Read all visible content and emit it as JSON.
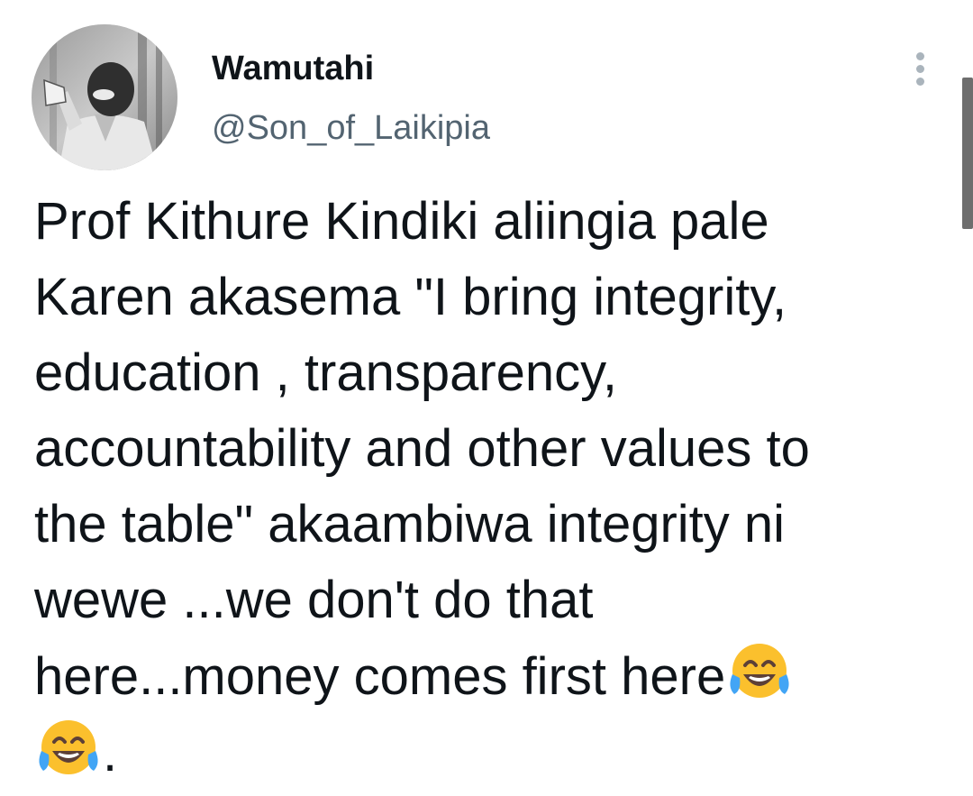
{
  "author": {
    "name": "Wamutahi",
    "handle": "@Son_of_Laikipia"
  },
  "tweet": {
    "lines": [
      "Prof Kithure Kindiki aliingia pale",
      "Karen akasema \"I bring integrity,",
      "education , transparency,",
      "accountability and other values to",
      "the table\" akaambiwa integrity ni",
      "wewe ...we don't do that",
      "here...money comes first here"
    ],
    "last_line_suffix": ".",
    "emoji": [
      "face-with-tears-of-joy",
      "face-with-tears-of-joy"
    ]
  },
  "icons": {
    "more": "more-vertical-icon",
    "avatar": "profile-avatar"
  },
  "colors": {
    "text": "#0f1419",
    "secondary_text": "#536471",
    "more_dots": "#aab4bc",
    "emoji_face": "#fbc02d",
    "emoji_tears": "#42a5f5"
  }
}
